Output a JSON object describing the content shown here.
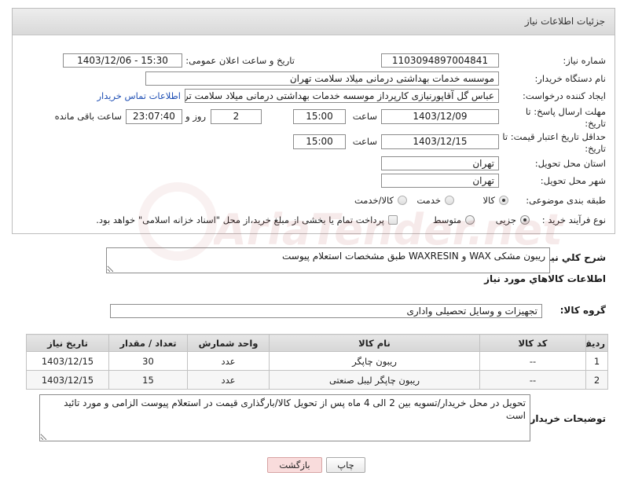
{
  "colors": {
    "link": "#1f4fb4",
    "header_bg": "#d9d9d9",
    "table_header_bg": "#d6d6d6",
    "back_button_bg": "#f9dcdc",
    "watermark": "#b44a4a"
  },
  "page": {
    "title": "جزئیات اطلاعات نیاز"
  },
  "fields": {
    "need_number": {
      "label": "شماره نیاز:",
      "value": "1103094897004841"
    },
    "announce": {
      "label": "تاریخ و ساعت اعلان عمومی:",
      "value": "1403/12/06 - 15:30"
    },
    "buyer_org": {
      "label": "نام دستگاه خریدار:",
      "value": "موسسه خدمات بهداشتی درمانی میلاد سلامت تهران"
    },
    "requester": {
      "label": "ایجاد کننده درخواست:",
      "value": "عباس گل آقاپورنیازی کارپرداز موسسه خدمات بهداشتی درمانی میلاد سلامت تر",
      "contact_link": "اطلاعات تماس خریدار"
    },
    "deadline": {
      "label_line1": "مهلت ارسال پاسخ: تا",
      "label_line2": "تاریخ:",
      "date": "1403/12/09",
      "time_label": "ساعت",
      "time": "15:00",
      "days": "2",
      "days_label": "روز و",
      "remaining": "23:07:40",
      "remaining_label": "ساعت باقی مانده"
    },
    "price_validity": {
      "label_line1": "حداقل تاریخ اعتبار قیمت: تا",
      "label_line2": "تاریخ:",
      "date": "1403/12/15",
      "time_label": "ساعت",
      "time": "15:00"
    },
    "province": {
      "label": "استان محل تحویل:",
      "value": "تهران"
    },
    "city": {
      "label": "شهر محل تحویل:",
      "value": "تهران"
    },
    "category": {
      "label": "طبقه بندی موضوعی:",
      "options": [
        {
          "label": "کالا",
          "checked": true
        },
        {
          "label": "خدمت",
          "checked": false
        },
        {
          "label": "کالا/خدمت",
          "checked": false
        }
      ]
    },
    "process": {
      "label": "نوع فرآیند خرید :",
      "options": [
        {
          "label": "جزیی",
          "checked": true
        },
        {
          "label": "متوسط",
          "checked": false
        }
      ],
      "treasury": {
        "label": "پرداخت تمام یا بخشی از مبلغ خرید،از محل \"اسناد خزانه اسلامی\" خواهد بود.",
        "checked": false
      }
    }
  },
  "description": {
    "label": "شرح کلي نياز:",
    "value": "ریبون مشکی WAX و WAXRESIN طبق مشخصات استعلام پیوست"
  },
  "goods": {
    "section_title": "اطلاعات کالاهاي مورد نياز",
    "group_label": "گروه کالا:",
    "group_value": "تجهیزات و وسایل تحصیلی واداری",
    "columns": {
      "row": "ردیف",
      "code": "کد کالا",
      "name": "نام کالا",
      "unit": "واحد شمارش",
      "qty": "تعداد / مقدار",
      "date": "تاریخ نیاز"
    },
    "rows": [
      {
        "row": "1",
        "code": "--",
        "name": "ریبون چاپگر",
        "unit": "عدد",
        "qty": "30",
        "date": "1403/12/15"
      },
      {
        "row": "2",
        "code": "--",
        "name": "ریبون چاپگر لیبل صنعتی",
        "unit": "عدد",
        "qty": "15",
        "date": "1403/12/15"
      }
    ]
  },
  "buyer_notes": {
    "label": "توضیحات خریدار:",
    "value": "تحویل در محل خریدار/تسویه بین 2 الی 4 ماه پس از تحویل کالا/بارگذاری قیمت در استعلام پیوست الزامی و مورد تائید است"
  },
  "buttons": {
    "print": "چاپ",
    "back": "بازگشت"
  },
  "watermark": {
    "text": "AriaTender.net"
  }
}
